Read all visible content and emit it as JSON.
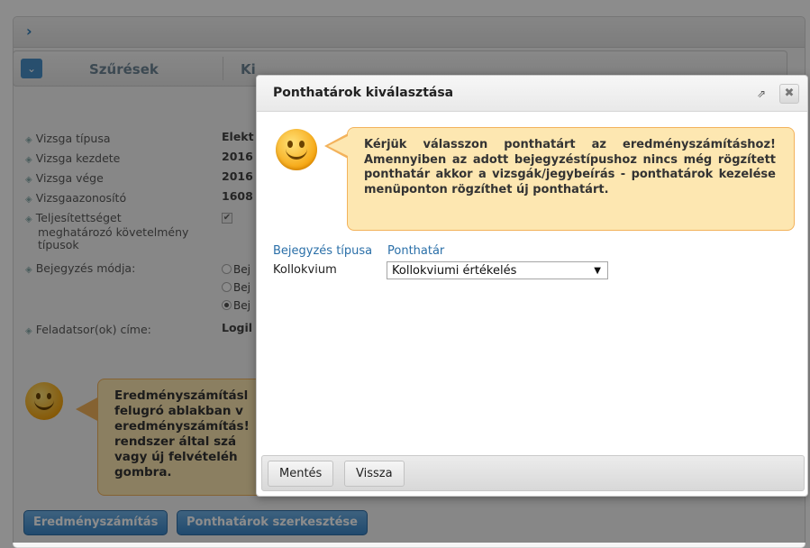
{
  "background": {
    "filter_label": "Szűrések",
    "filter_tab2_label": "Ki",
    "form_rows": [
      {
        "label": "Vizsga típusa",
        "value": "Elekt"
      },
      {
        "label": "Vizsga kezdete",
        "value": "2016"
      },
      {
        "label": "Vizsga vége",
        "value": "2016"
      },
      {
        "label": "Vizsgaazonosító",
        "value": "1608"
      }
    ],
    "teljesitett_label_1": "Teljesítettséget",
    "teljesitett_label_2": "meghatározó követelmény",
    "teljesitett_label_3": "típusok",
    "bejegyzes_modja_label": "Bejegyzés módja:",
    "radio_labels": [
      "Bej",
      "Bej",
      "Bej"
    ],
    "feladatsor_label": "Feladatsor(ok) címe:",
    "feladatsor_value": "Logil",
    "bubble_lines": [
      "Eredményszámításl",
      "felugró ablakban v",
      "eredményszámítás!",
      "rendszer által szá",
      "vagy új felvételéh",
      "gombra."
    ],
    "btn_eredmenyszamitas": "Eredményszámítás",
    "btn_ponthatarok_szerkesztese": "Ponthatárok szerkesztése"
  },
  "modal": {
    "title": "Ponthatárok kiválasztása",
    "popout_glyph": "⇗",
    "close_glyph": "✖",
    "hint_text": "Kérjük válasszon ponthatárt az eredményszámításhoz! Amennyiben az adott bejegyzéstípushoz nincs még rögzített ponthatár akkor a vizsgák/jegybeírás - ponthatárok kezelése menüponton rögzíthet új ponthatárt.",
    "col_bejegyzes_tipusa": "Bejegyzés típusa",
    "col_ponthatar": "Ponthatár",
    "row_label": "Kollokvium",
    "select_value": "Kollokviumi értékelés",
    "save_label": "Mentés",
    "back_label": "Vissza"
  }
}
